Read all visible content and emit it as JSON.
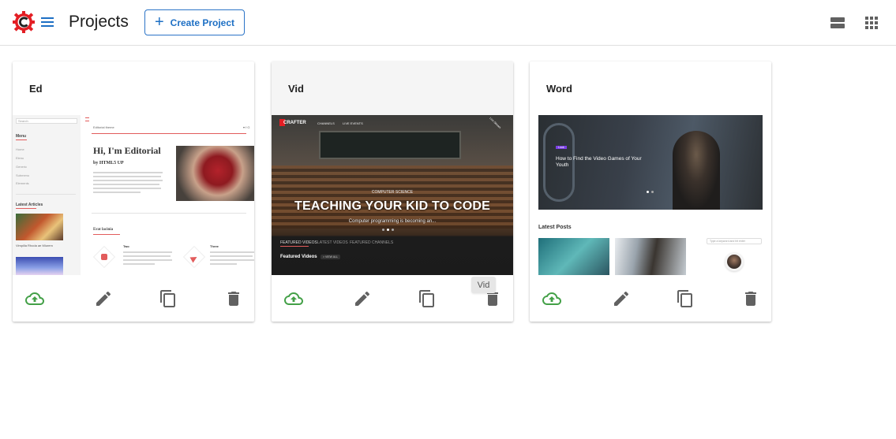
{
  "header": {
    "title": "Projects",
    "create_button_label": "Create Project"
  },
  "projects": [
    {
      "name": "Ed",
      "thumb": {
        "nav_title": "Menu",
        "nav_items": [
          "Home",
          "Elenu",
          "Generic",
          "Submenu",
          "Elements"
        ],
        "sidebar_heading": "Latest Articles",
        "search_label": "Search",
        "topbar_label": "Editorial theme",
        "headline": "Hi, I'm Editorial",
        "subhead": "by HTML5 UP",
        "section_title": "Erat lacinia",
        "feature_1": "Two",
        "feature_2": "Three",
        "sidebar_caption": "Vimpilla Rhoda ae Miurem"
      }
    },
    {
      "name": "Vid",
      "thumb": {
        "brand": "CRAFTER",
        "nav_1": "CHANNELS",
        "nav_2": "LIVE EVENTS",
        "category": "COMPUTER SCIENCE",
        "headline": "TEACHING YOUR KID TO CODE",
        "subline": "Computer programming is becoming an...",
        "tab_1": "FEATURED VIDEOS",
        "tab_2": "LATEST VIDEOS",
        "tab_3": "FEATURED CHANNELS",
        "section": "Featured Videos",
        "view_all": "> VIEW ALL",
        "corner_badge": "Live Stream"
      },
      "tooltip": "Vid"
    },
    {
      "name": "Word",
      "thumb": {
        "tag": "Look",
        "headline": "How to Find the Video Games of Your Youth",
        "section": "Latest Posts",
        "search_placeholder": "Type a keyword and hit enter"
      }
    }
  ],
  "colors": {
    "accent": "#1d6fc4",
    "publish": "#43a047",
    "icon": "#616161",
    "brand_red": "#e31e24"
  },
  "icons": {
    "publish": "cloud-upload-icon",
    "edit": "pencil-icon",
    "duplicate": "copy-icon",
    "delete": "trash-icon",
    "menu": "hamburger-icon",
    "list_view": "list-view-icon",
    "grid_view": "grid-view-icon"
  }
}
